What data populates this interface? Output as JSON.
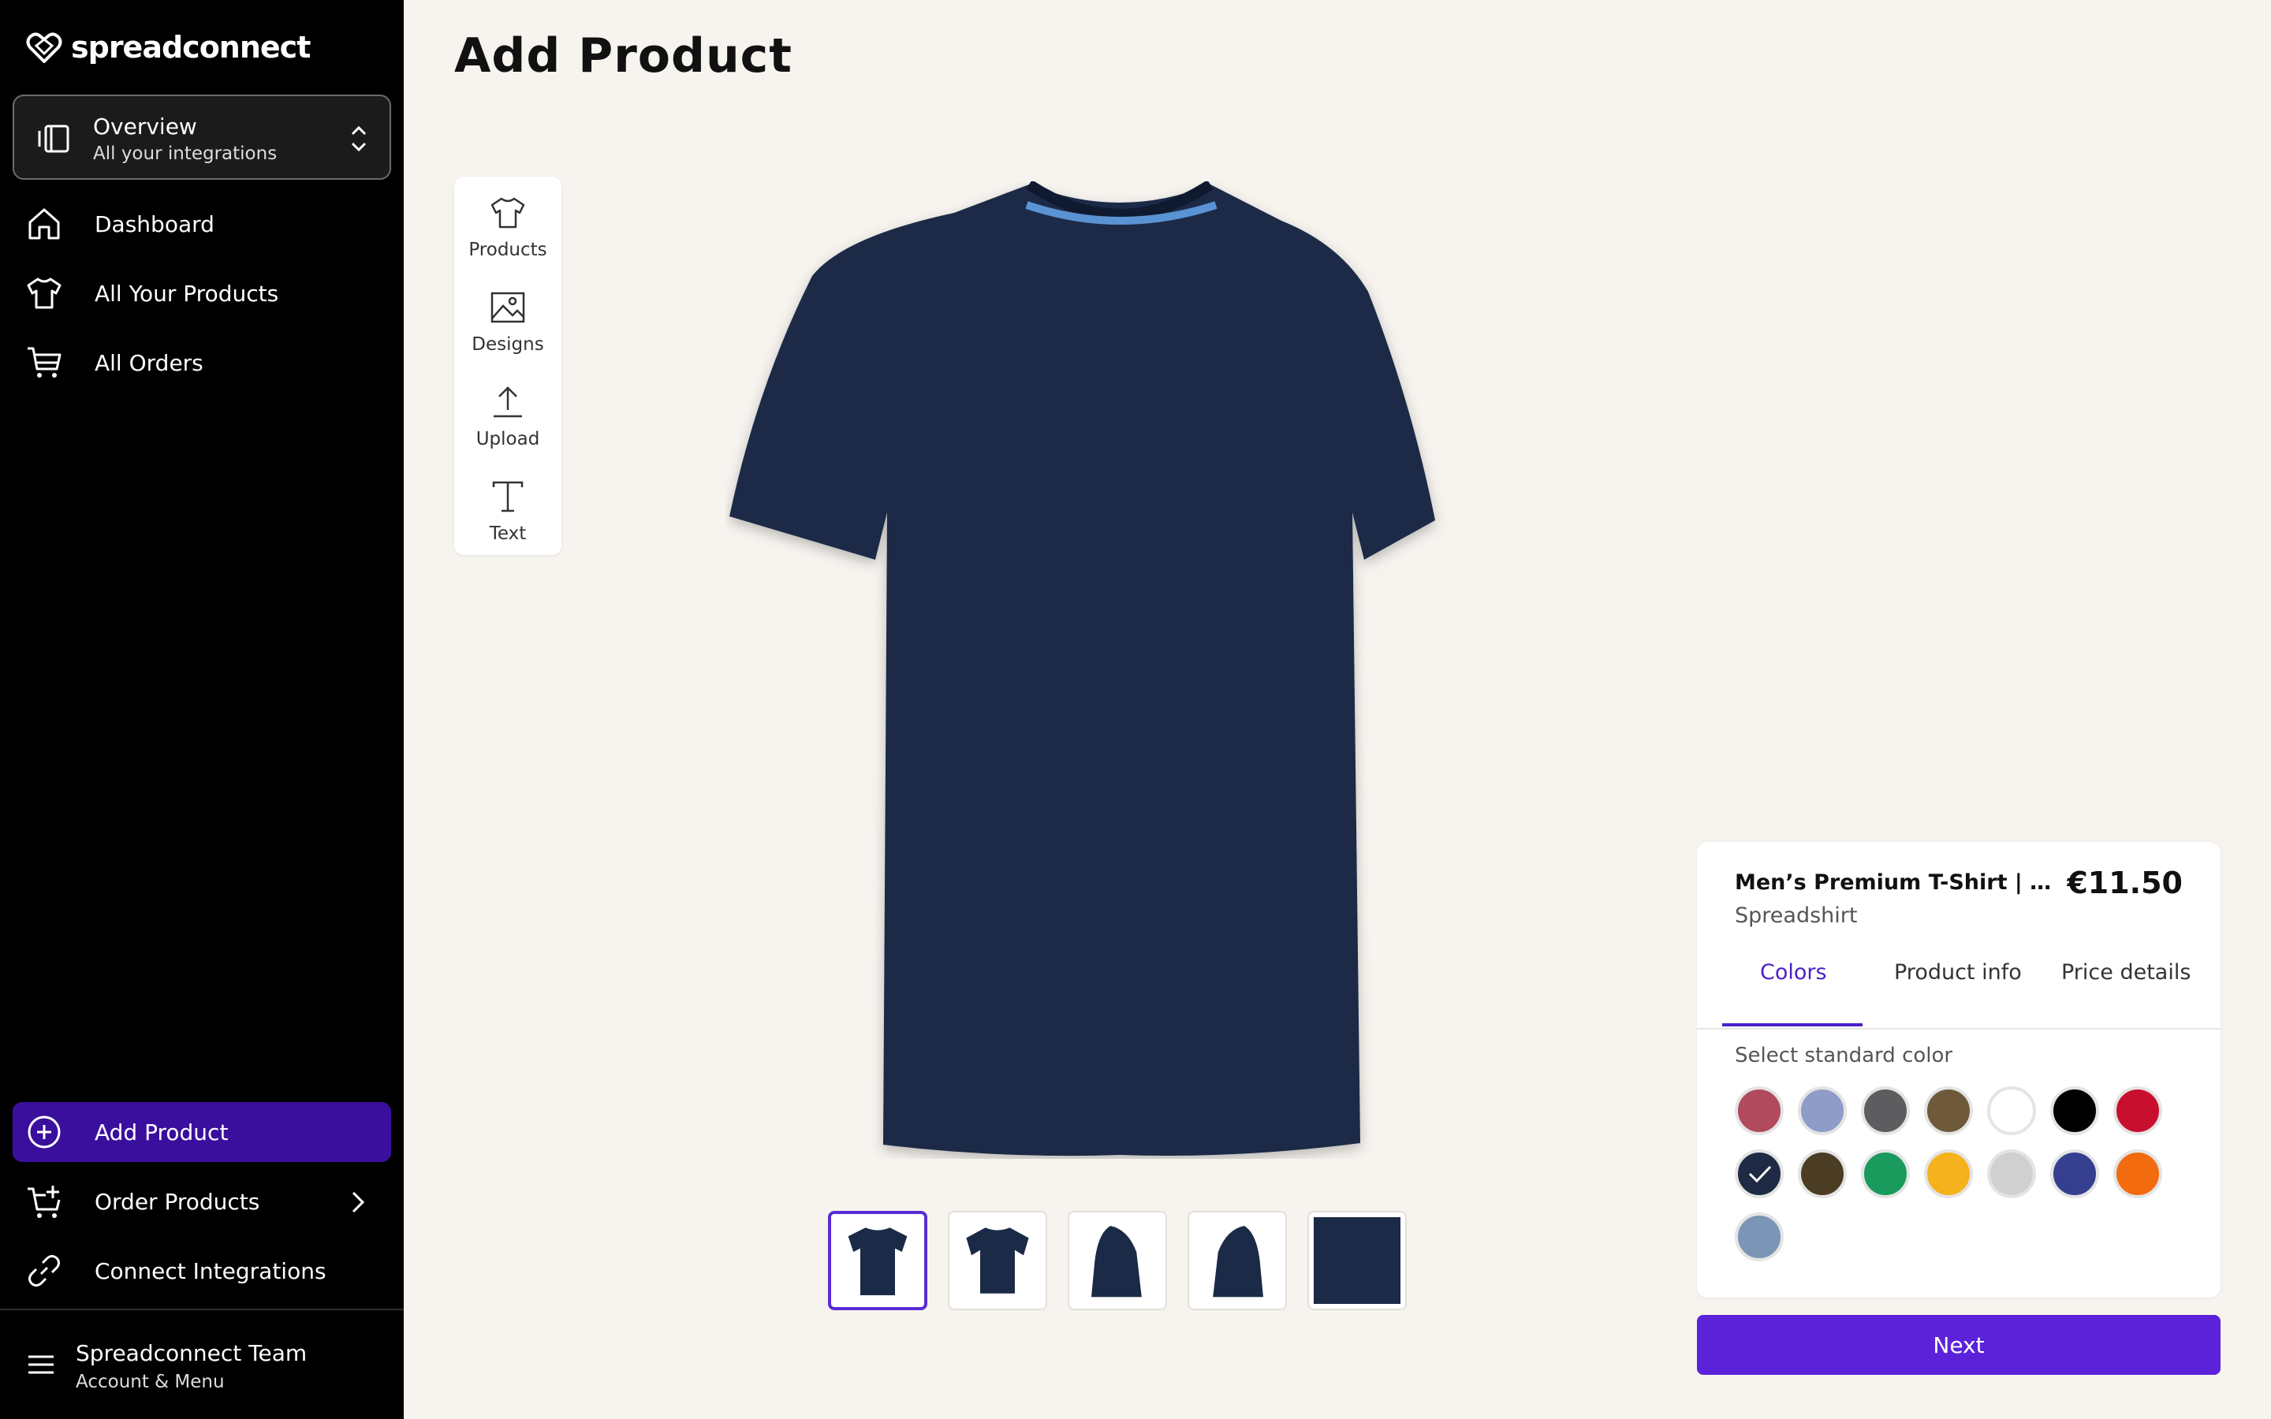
{
  "sidebar": {
    "brand": "spreadconnect",
    "context": {
      "title": "Overview",
      "subtitle": "All your integrations"
    },
    "nav": [
      {
        "label": "Dashboard",
        "icon": "home-icon"
      },
      {
        "label": "All Your Products",
        "icon": "tshirt-icon"
      },
      {
        "label": "All Orders",
        "icon": "cart-icon"
      }
    ],
    "bottom_nav": [
      {
        "label": "Add Product",
        "icon": "plus-circle-icon",
        "active": true
      },
      {
        "label": "Order Products",
        "icon": "cart-plus-icon"
      },
      {
        "label": "Connect Integrations",
        "icon": "link-icon"
      }
    ],
    "account": {
      "name": "Spreadconnect Team",
      "subtitle": "Account & Menu"
    }
  },
  "page": {
    "title": "Add Product"
  },
  "toolbox": [
    {
      "label": "Products",
      "icon": "tshirt-icon"
    },
    {
      "label": "Designs",
      "icon": "image-icon"
    },
    {
      "label": "Upload",
      "icon": "upload-icon"
    },
    {
      "label": "Text",
      "icon": "text-icon"
    }
  ],
  "product": {
    "name": "Men’s Premium T-Shirt | Spreadshirt",
    "brand": "Spreadshirt",
    "price": "€11.50",
    "shirt_color": "#1a2a47",
    "collar_color": "#5a93d4",
    "tabs": [
      "Colors",
      "Product info",
      "Price details"
    ],
    "active_tab": "Colors",
    "color_heading": "Select standard color",
    "colors": [
      "#b04a5c",
      "#8e9cc7",
      "#5d5d60",
      "#6e5a3a",
      "#ffffff",
      "#000000",
      "#c8102e",
      "#1f2a44",
      "#4a3d24",
      "#1a9a5c",
      "#f5b21c",
      "#d0d0d0",
      "#363f8f",
      "#f26b0f",
      "#7a95b5"
    ],
    "selected_color_index": 7
  },
  "thumbnails": [
    "front",
    "front-model",
    "side-left",
    "side-right",
    "fabric-detail"
  ],
  "actions": {
    "next": "Next"
  },
  "colors": {
    "accent": "#5b22d9",
    "active_nav": "#3b0f9e",
    "sidebar_bg": "#000000",
    "page_bg": "#f7f4ef"
  }
}
